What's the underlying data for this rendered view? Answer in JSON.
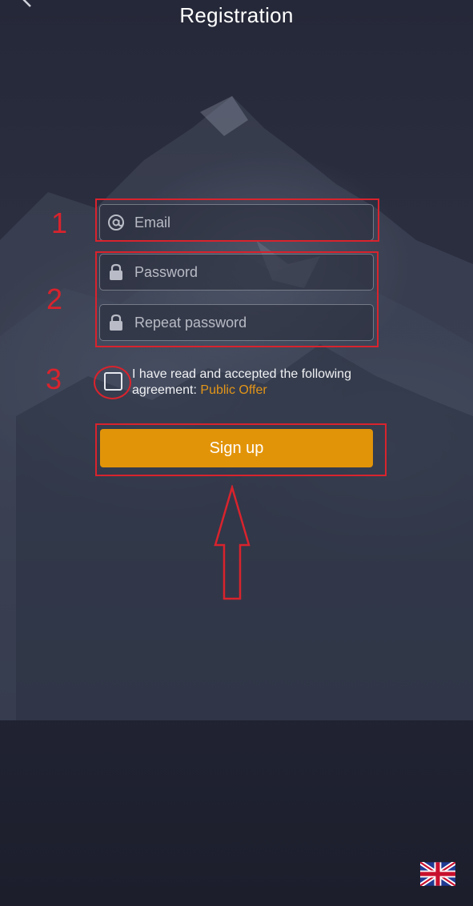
{
  "header": {
    "title": "Registration"
  },
  "form": {
    "email_placeholder": "Email",
    "password_placeholder": "Password",
    "repeat_password_placeholder": "Repeat password",
    "agreement_text": "I have read and accepted the following agreement: ",
    "agreement_link": "Public Offer",
    "signup_label": "Sign up"
  },
  "annotations": {
    "step1": "1",
    "step2": "2",
    "step3": "3"
  },
  "colors": {
    "accent": "#e29409",
    "link": "#e39518",
    "annotation": "#d9232d",
    "background": "#1d1f2e"
  },
  "icons": {
    "back": "back-arrow-icon",
    "email": "at-sign-icon",
    "password": "lock-icon",
    "language": "uk-flag-icon"
  }
}
